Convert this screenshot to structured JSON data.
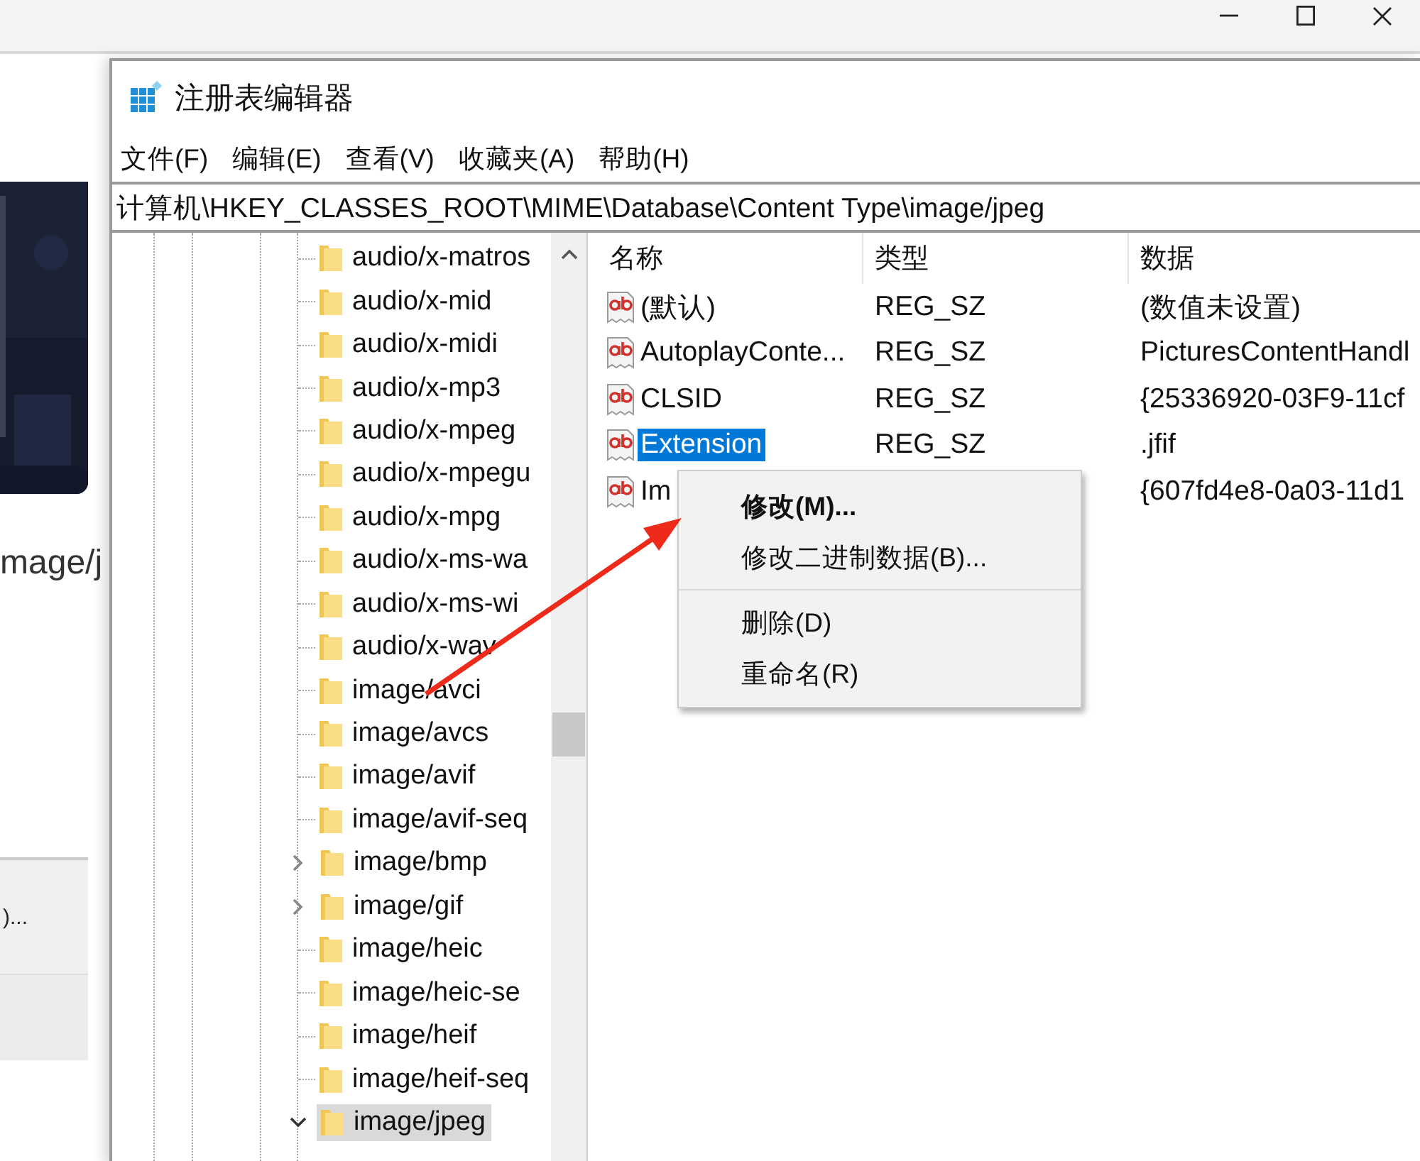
{
  "background_window": {
    "title_controls": [
      {
        "kind": "minimize"
      },
      {
        "kind": "maximize"
      },
      {
        "kind": "close"
      }
    ],
    "caption": "mage/j",
    "panel_text": ")..."
  },
  "window": {
    "title": "注册表编辑器",
    "menu": [
      "文件(F)",
      "编辑(E)",
      "查看(V)",
      "收藏夹(A)",
      "帮助(H)"
    ],
    "address": "计算机\\HKEY_CLASSES_ROOT\\MIME\\Database\\Content Type\\image/jpeg"
  },
  "tree": {
    "items": [
      {
        "label": "audio/x-matros",
        "expandable": false,
        "expanded": false,
        "selected": false
      },
      {
        "label": "audio/x-mid",
        "expandable": false,
        "expanded": false,
        "selected": false
      },
      {
        "label": "audio/x-midi",
        "expandable": false,
        "expanded": false,
        "selected": false
      },
      {
        "label": "audio/x-mp3",
        "expandable": false,
        "expanded": false,
        "selected": false
      },
      {
        "label": "audio/x-mpeg",
        "expandable": false,
        "expanded": false,
        "selected": false
      },
      {
        "label": "audio/x-mpegu",
        "expandable": false,
        "expanded": false,
        "selected": false
      },
      {
        "label": "audio/x-mpg",
        "expandable": false,
        "expanded": false,
        "selected": false
      },
      {
        "label": "audio/x-ms-wa",
        "expandable": false,
        "expanded": false,
        "selected": false
      },
      {
        "label": "audio/x-ms-wi",
        "expandable": false,
        "expanded": false,
        "selected": false
      },
      {
        "label": "audio/x-wav",
        "expandable": false,
        "expanded": false,
        "selected": false
      },
      {
        "label": "image/avci",
        "expandable": false,
        "expanded": false,
        "selected": false
      },
      {
        "label": "image/avcs",
        "expandable": false,
        "expanded": false,
        "selected": false
      },
      {
        "label": "image/avif",
        "expandable": false,
        "expanded": false,
        "selected": false
      },
      {
        "label": "image/avif-seq",
        "expandable": false,
        "expanded": false,
        "selected": false
      },
      {
        "label": "image/bmp",
        "expandable": true,
        "expanded": false,
        "selected": false
      },
      {
        "label": "image/gif",
        "expandable": true,
        "expanded": false,
        "selected": false
      },
      {
        "label": "image/heic",
        "expandable": false,
        "expanded": false,
        "selected": false
      },
      {
        "label": "image/heic-se",
        "expandable": false,
        "expanded": false,
        "selected": false
      },
      {
        "label": "image/heif",
        "expandable": false,
        "expanded": false,
        "selected": false
      },
      {
        "label": "image/heif-seq",
        "expandable": false,
        "expanded": false,
        "selected": false
      },
      {
        "label": "image/jpeg",
        "expandable": true,
        "expanded": true,
        "selected": true
      }
    ]
  },
  "values": {
    "columns": [
      "名称",
      "类型",
      "数据"
    ],
    "rows": [
      {
        "name": "(默认)",
        "type": "REG_SZ",
        "data": "(数值未设置)",
        "selected": false
      },
      {
        "name": "AutoplayConte...",
        "type": "REG_SZ",
        "data": "PicturesContentHandl",
        "selected": false
      },
      {
        "name": "CLSID",
        "type": "REG_SZ",
        "data": "{25336920-03F9-11cf",
        "selected": false
      },
      {
        "name": "Extension",
        "type": "REG_SZ",
        "data": ".jfif",
        "selected": true
      },
      {
        "name": "Im",
        "data": "{607fd4e8-0a03-11d1",
        "selected": false
      }
    ]
  },
  "context_menu": {
    "items": [
      {
        "label": "修改(M)...",
        "default": true,
        "separator_before": false
      },
      {
        "label": "修改二进制数据(B)...",
        "default": false,
        "separator_before": false
      },
      {
        "label": "删除(D)",
        "default": false,
        "separator_before": true
      },
      {
        "label": "重命名(R)",
        "default": false,
        "separator_before": false
      }
    ]
  },
  "annotation": {
    "kind": "arrow"
  }
}
